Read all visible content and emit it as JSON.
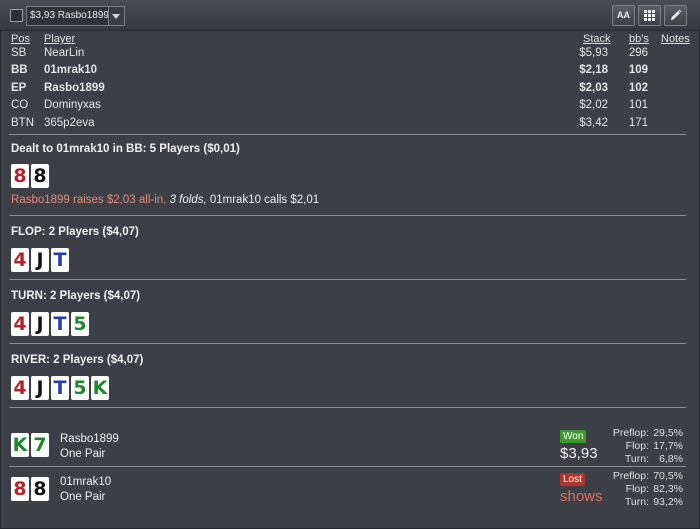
{
  "toolbar": {
    "combo_value": "$3,93 Rasbo1899",
    "font_button_label": "AA"
  },
  "players": {
    "headers": {
      "pos": "Pos",
      "player": "Player",
      "stack": "Stack",
      "bbs": "bb's",
      "notes": "Notes"
    },
    "rows": [
      {
        "pos": "SB",
        "player": "NearLin",
        "stack": "$5,93",
        "bbs": "296",
        "bold": false
      },
      {
        "pos": "BB",
        "player": "01mrak10",
        "stack": "$2,18",
        "bbs": "109",
        "bold": true
      },
      {
        "pos": "EP",
        "player": "Rasbo1899",
        "stack": "$2,03",
        "bbs": "102",
        "bold": true
      },
      {
        "pos": "CO",
        "player": "Dominyxas",
        "stack": "$2,02",
        "bbs": "101",
        "bold": false
      },
      {
        "pos": "BTN",
        "player": "365p2eva",
        "stack": "$3,42",
        "bbs": "171",
        "bold": false
      }
    ]
  },
  "preflop": {
    "title": "Dealt to 01mrak10 in BB: 5 Players ($0,01)",
    "cards": [
      {
        "rank": "8",
        "color": "#b8202a"
      },
      {
        "rank": "8",
        "color": "#111111"
      }
    ],
    "action_raise": "Rasbo1899 raises $2,03 all-in,",
    "action_folds": "3 folds,",
    "action_call": "01mrak10 calls $2,01"
  },
  "flop": {
    "title": "FLOP: 2 Players ($4,07)",
    "cards": [
      {
        "rank": "4",
        "color": "#b8202a"
      },
      {
        "rank": "J",
        "color": "#111111"
      },
      {
        "rank": "T",
        "color": "#1f3fb0"
      }
    ]
  },
  "turn": {
    "title": "TURN: 2 Players ($4,07)",
    "cards": [
      {
        "rank": "4",
        "color": "#b8202a"
      },
      {
        "rank": "J",
        "color": "#111111"
      },
      {
        "rank": "T",
        "color": "#1f3fb0"
      },
      {
        "rank": "5",
        "color": "#1c8a2a"
      }
    ]
  },
  "river": {
    "title": "RIVER: 2 Players ($4,07)",
    "cards": [
      {
        "rank": "4",
        "color": "#b8202a"
      },
      {
        "rank": "J",
        "color": "#111111"
      },
      {
        "rank": "T",
        "color": "#1f3fb0"
      },
      {
        "rank": "5",
        "color": "#1c8a2a"
      },
      {
        "rank": "K",
        "color": "#1c8a2a"
      }
    ]
  },
  "results": [
    {
      "name": "Rasbo1899",
      "hand": "One Pair",
      "cards": [
        {
          "rank": "K",
          "color": "#1c8a2a"
        },
        {
          "rank": "7",
          "color": "#1c8a2a"
        }
      ],
      "badge": "Won",
      "amount": "$3,93",
      "equity": [
        {
          "label": "Preflop:",
          "value": "29,5%"
        },
        {
          "label": "Flop:",
          "value": "17,7%"
        },
        {
          "label": "Turn:",
          "value": "6,8%"
        }
      ]
    },
    {
      "name": "01mrak10",
      "hand": "One Pair",
      "cards": [
        {
          "rank": "8",
          "color": "#b8202a"
        },
        {
          "rank": "8",
          "color": "#111111"
        }
      ],
      "badge": "Lost",
      "amount": "shows",
      "equity": [
        {
          "label": "Preflop:",
          "value": "70,5%"
        },
        {
          "label": "Flop:",
          "value": "82,3%"
        },
        {
          "label": "Turn:",
          "value": "93,2%"
        }
      ]
    }
  ],
  "colors": {
    "background": "#3c3f45",
    "won": "#3a9a2a",
    "lost": "#b3322a",
    "raise_text": "#e38c7c"
  }
}
